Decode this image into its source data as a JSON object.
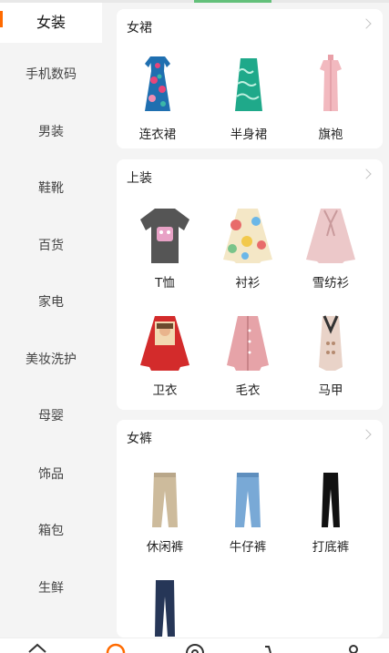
{
  "sidebar": {
    "items": [
      {
        "label": "女装"
      },
      {
        "label": "手机数码"
      },
      {
        "label": "男装"
      },
      {
        "label": "鞋靴"
      },
      {
        "label": "百货"
      },
      {
        "label": "家电"
      },
      {
        "label": "美妆洗护"
      },
      {
        "label": "母婴"
      },
      {
        "label": "饰品"
      },
      {
        "label": "箱包"
      },
      {
        "label": "生鲜"
      }
    ]
  },
  "sections": [
    {
      "title": "女裙",
      "items": [
        {
          "label": "连衣裙",
          "icon": "floral-dress-icon"
        },
        {
          "label": "半身裙",
          "icon": "green-skirt-icon"
        },
        {
          "label": "旗袍",
          "icon": "pink-qipao-icon"
        }
      ]
    },
    {
      "title": "上装",
      "items": [
        {
          "label": "T恤",
          "icon": "tshirt-icon"
        },
        {
          "label": "衬衫",
          "icon": "shirt-icon"
        },
        {
          "label": "雪纺衫",
          "icon": "chiffon-blouse-icon"
        },
        {
          "label": "卫衣",
          "icon": "sweatshirt-icon"
        },
        {
          "label": "毛衣",
          "icon": "cardigan-icon"
        },
        {
          "label": "马甲",
          "icon": "vest-icon"
        }
      ]
    },
    {
      "title": "女裤",
      "items": [
        {
          "label": "休闲裤",
          "icon": "casual-pants-icon"
        },
        {
          "label": "牛仔裤",
          "icon": "jeans-icon"
        },
        {
          "label": "打底裤",
          "icon": "leggings-icon"
        },
        {
          "label": "",
          "icon": "navy-trousers-icon"
        }
      ]
    }
  ],
  "tabbar": {
    "tabs": [
      {
        "icon": "home-icon"
      },
      {
        "icon": "category-icon"
      },
      {
        "icon": "message-icon"
      },
      {
        "icon": "cart-icon"
      },
      {
        "icon": "user-icon"
      }
    ]
  },
  "colors": {
    "accent": "#ff6a00",
    "progress": "#63c07a"
  }
}
